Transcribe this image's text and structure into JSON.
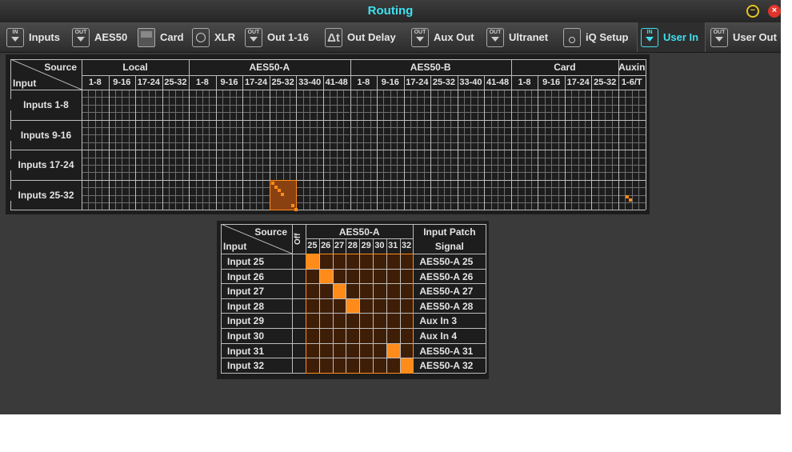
{
  "window": {
    "title": "Routing"
  },
  "tabs": [
    {
      "label": "Inputs",
      "icon": "in-icon",
      "icon_text": "IN",
      "active": false
    },
    {
      "label": "AES50",
      "icon": "out-icon",
      "icon_text": "OUT",
      "active": false
    },
    {
      "label": "Card",
      "icon": "card-icon",
      "icon_text": "",
      "active": false
    },
    {
      "label": "XLR",
      "icon": "xlr-icon",
      "icon_text": "",
      "active": false
    },
    {
      "label": "Out 1-16",
      "icon": "out-icon",
      "icon_text": "OUT",
      "active": false
    },
    {
      "label": "Out Delay",
      "icon": "delta-t-icon",
      "icon_text": "Δt",
      "active": false
    },
    {
      "label": "Aux Out",
      "icon": "out-icon",
      "icon_text": "OUT",
      "active": false
    },
    {
      "label": "Ultranet",
      "icon": "out-icon",
      "icon_text": "OUT",
      "active": false
    },
    {
      "label": "iQ Setup",
      "icon": "speaker-icon",
      "icon_text": "",
      "active": false
    },
    {
      "label": "User In",
      "icon": "in-icon",
      "icon_text": "IN",
      "active": true
    },
    {
      "label": "User Out",
      "icon": "out-icon",
      "icon_text": "OUT",
      "active": false
    }
  ],
  "overview": {
    "corner_source": "Source",
    "corner_input": "Input",
    "groups": [
      {
        "label": "Local",
        "cols": [
          "1-8",
          "9-16",
          "17-24",
          "25-32"
        ]
      },
      {
        "label": "AES50-A",
        "cols": [
          "1-8",
          "9-16",
          "17-24",
          "25-32",
          "33-40",
          "41-48"
        ]
      },
      {
        "label": "AES50-B",
        "cols": [
          "1-8",
          "9-16",
          "17-24",
          "25-32",
          "33-40",
          "41-48"
        ]
      },
      {
        "label": "Card",
        "cols": [
          "1-8",
          "9-16",
          "17-24",
          "25-32"
        ]
      },
      {
        "label": "Auxin",
        "cols": [
          "1-6/T"
        ]
      }
    ],
    "rows": [
      "Inputs 1-8",
      "Inputs 9-16",
      "Inputs 17-24",
      "Inputs 25-32"
    ],
    "highlight": {
      "row": 3,
      "col": 7
    }
  },
  "detail": {
    "corner_source": "Source",
    "corner_input": "Input",
    "off_label": "Off",
    "group_label": "AES50-A",
    "cols": [
      "25",
      "26",
      "27",
      "28",
      "29",
      "30",
      "31",
      "32"
    ],
    "patch_header": "Input Patch",
    "signal_header": "Signal",
    "rows": [
      {
        "input": "Input 25",
        "signal": "AES50-A 25",
        "sel": 0
      },
      {
        "input": "Input 26",
        "signal": "AES50-A 26",
        "sel": 1
      },
      {
        "input": "Input 27",
        "signal": "AES50-A 27",
        "sel": 2
      },
      {
        "input": "Input 28",
        "signal": "AES50-A 28",
        "sel": 3
      },
      {
        "input": "Input 29",
        "signal": "Aux In 3",
        "sel": -1
      },
      {
        "input": "Input 30",
        "signal": "Aux In 4",
        "sel": -1
      },
      {
        "input": "Input 31",
        "signal": "AES50-A 31",
        "sel": 6
      },
      {
        "input": "Input 32",
        "signal": "AES50-A 32",
        "sel": 7
      }
    ]
  },
  "colors": {
    "accent": "#3fe0ee",
    "patch": "#ff8c1a"
  }
}
